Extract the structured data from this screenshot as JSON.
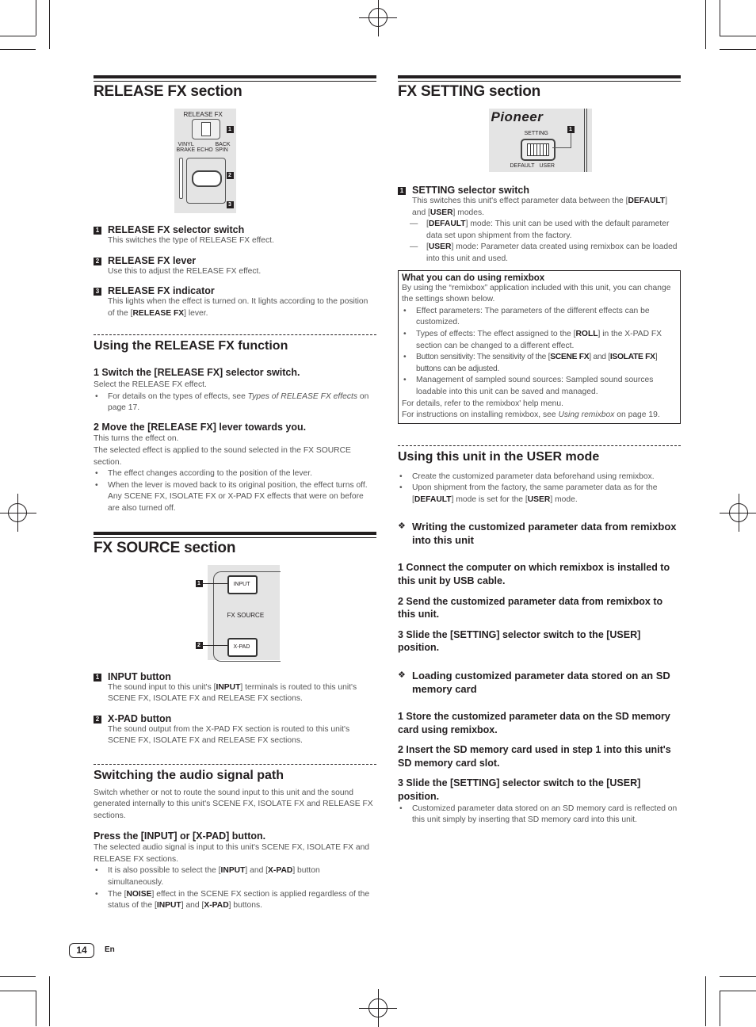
{
  "page": {
    "number": "14",
    "language": "En"
  },
  "release_fx": {
    "title": "RELEASE FX section",
    "figure": {
      "panel_label": "RELEASE FX",
      "pos_left": "VINYL BRAKE",
      "pos_mid": "ECHO",
      "pos_right": "BACK SPIN",
      "pos_left_1": "VINYL",
      "pos_left_2": "BRAKE",
      "pos_right_1": "BACK",
      "pos_right_2": "SPIN",
      "callouts": [
        "1",
        "2",
        "3"
      ]
    },
    "items": [
      {
        "num": "1",
        "title": "RELEASE FX selector switch",
        "desc": "This switches the type of RELEASE FX effect."
      },
      {
        "num": "2",
        "title": "RELEASE FX lever",
        "desc": "Use this to adjust the RELEASE FX effect."
      },
      {
        "num": "3",
        "title": "RELEASE FX indicator",
        "desc_a": "This lights when the effect is turned on. It lights according to the position of the [",
        "desc_k": "RELEASE FX",
        "desc_b": "] lever."
      }
    ],
    "using": {
      "title": "Using the RELEASE FX function",
      "step1": "1   Switch the [RELEASE FX] selector switch.",
      "step1_body": "Select the RELEASE FX effect.",
      "step1_bullet_a": "For details on the types of effects, see ",
      "step1_bullet_link": "Types of RELEASE FX effects",
      "step1_bullet_b": " on page 17.",
      "step2": "2   Move the [RELEASE FX] lever towards you.",
      "step2_body1": "This turns the effect on.",
      "step2_body2": "The selected effect is applied to the sound selected in the FX SOURCE section.",
      "step2_bullets": [
        "The effect changes according to the position of the lever.",
        "When the lever is moved back to its original position, the effect turns off. Any SCENE FX, ISOLATE FX or X-PAD FX effects that were on before are also turned off."
      ]
    }
  },
  "fx_source": {
    "title": "FX SOURCE section",
    "figure": {
      "input_label": "INPUT",
      "xpad_label": "X-PAD",
      "panel_label": "FX SOURCE",
      "callouts": [
        "1",
        "2"
      ]
    },
    "items": [
      {
        "num": "1",
        "title": "INPUT button",
        "desc_a": "The sound input to this unit's [",
        "desc_k": "INPUT",
        "desc_b": "] terminals is routed to this unit's SCENE FX, ISOLATE FX and RELEASE FX sections."
      },
      {
        "num": "2",
        "title": "X-PAD button",
        "desc": "The sound output from the X-PAD FX section is routed to this unit's SCENE FX, ISOLATE FX and RELEASE FX sections."
      }
    ],
    "switching": {
      "title": "Switching the audio signal path",
      "intro": "Switch whether or not to route the sound input to this unit and the sound generated internally to this unit's SCENE FX, ISOLATE FX and RELEASE FX sections.",
      "step": "Press the [INPUT] or [X-PAD] button.",
      "step_body": "The selected audio signal is input to this unit's SCENE FX, ISOLATE FX and RELEASE FX sections.",
      "b1_a": "It is also possible to select the [",
      "b1_k1": "INPUT",
      "b1_m": "] and [",
      "b1_k2": "X-PAD",
      "b1_b": "] button simultaneously.",
      "b2_a": "The [",
      "b2_k1": "NOISE",
      "b2_m1": "] effect in the SCENE FX section is applied regardless of the status of the [",
      "b2_k2": "INPUT",
      "b2_m2": "] and [",
      "b2_k3": "X-PAD",
      "b2_b": "] buttons."
    }
  },
  "fx_setting": {
    "title": "FX SETTING section",
    "figure": {
      "brand": "Pioneer",
      "switch_label": "SETTING",
      "pos_default": "DEFAULT",
      "pos_user": "USER",
      "callouts": [
        "1"
      ]
    },
    "item": {
      "num": "1",
      "title": "SETTING selector switch",
      "desc_a": "This switches this unit's effect parameter data between the [",
      "desc_k1": "DEFAULT",
      "desc_m": "] and [",
      "desc_k2": "USER",
      "desc_b": "] modes.",
      "d1_a": "[",
      "d1_k": "DEFAULT",
      "d1_b": "] mode: This unit can be used with the default parameter data set upon shipment from the factory.",
      "d2_a": "[",
      "d2_k": "USER",
      "d2_b": "] mode: Parameter data created using remixbox can be loaded into this unit and used."
    },
    "remixbox_box": {
      "title": "What you can do using remixbox",
      "intro": "By using the “remixbox” application included with this unit, you can change the settings shown below.",
      "b1": "Effect parameters: The parameters of the different effects can be customized.",
      "b2_a": "Types of effects: The effect assigned to the [",
      "b2_k": "ROLL",
      "b2_b": "] in the X-PAD FX section can be changed to a different effect.",
      "b3_a": "Button sensitivity: The sensitivity of the [",
      "b3_k1": "SCENE FX",
      "b3_m": "] and [",
      "b3_k2": "ISOLATE FX",
      "b3_b": "] buttons can be adjusted.",
      "b4": "Management of sampled sound sources: Sampled sound sources loadable into this unit can be saved and managed.",
      "footer1": "For details, refer to the remixbox' help menu.",
      "footer2_a": "For instructions on installing remixbox, see ",
      "footer2_link": "Using remixbox",
      "footer2_b": " on page 19."
    },
    "user_mode": {
      "title": "Using this unit in the USER mode",
      "b1": "Create the customized parameter data beforehand using remixbox.",
      "b2_a": "Upon shipment from the factory, the same parameter data as for the [",
      "b2_k1": "DEFAULT",
      "b2_m": "] mode is set for the [",
      "b2_k2": "USER",
      "b2_b": "] mode.",
      "writing": {
        "heading": "Writing the customized parameter data from remixbox into this unit",
        "steps": [
          "1   Connect the computer on which remixbox is installed to this unit by USB cable.",
          "2   Send the customized parameter data from remixbox to this unit.",
          "3   Slide the [SETTING] selector switch to the [USER] position."
        ]
      },
      "loading": {
        "heading": "Loading customized parameter data stored on an SD memory card",
        "steps": [
          "1   Store the customized parameter data on the SD memory card using remixbox.",
          "2   Insert the SD memory card used in step 1 into this unit's SD memory card slot.",
          "3   Slide the [SETTING] selector switch to the [USER] position."
        ],
        "bullet": "Customized parameter data stored on an SD memory card is reflected on this unit simply by inserting that SD memory card into this unit."
      }
    }
  },
  "icons": {
    "bullet": "•",
    "diamond": "❖",
    "dash": "—"
  }
}
